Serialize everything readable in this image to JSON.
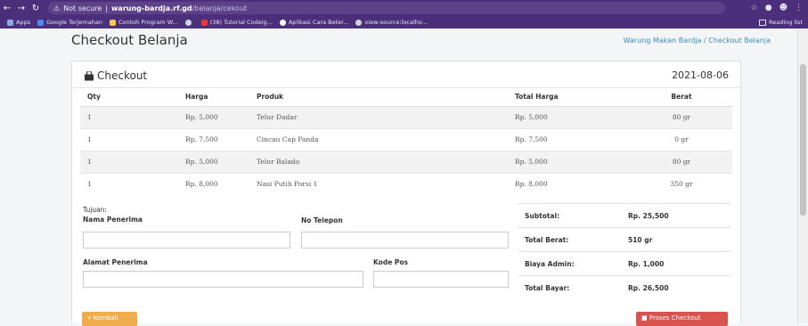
{
  "browser": {
    "security": "Not secure",
    "domain": "warung-bardja.rf.gd",
    "path": "/belanja/cekout",
    "bookmarks": [
      "Apps",
      "Google Terjemahan",
      "Contoh Program W...",
      "(38) Tutorial Codeig...",
      "Aplikasi Cara Beter...",
      "view-source:localho..."
    ],
    "reading_list": "Reading list"
  },
  "page": {
    "title": "Checkout Belanja",
    "breadcrumb": "Warung Makan Bardja  /  Checkout Belanja"
  },
  "card": {
    "title": "Checkout",
    "date": "2021-08-06"
  },
  "table": {
    "headers": [
      "Qty",
      "Harga",
      "Produk",
      "Total Harga",
      "Berat"
    ],
    "rows": [
      [
        "1",
        "Rp. 5,000",
        "Telur Dadar",
        "Rp. 5,000",
        "80 gr"
      ],
      [
        "1",
        "Rp. 7,500",
        "Cincau Cap Panda",
        "Rp. 7,500",
        "0 gr"
      ],
      [
        "1",
        "Rp. 5,000",
        "Telur Balado",
        "Rp. 5,000",
        "80 gr"
      ],
      [
        "1",
        "Rp. 8,000",
        "Nasi Putih Porsi 1",
        "Rp. 8,000",
        "350 gr"
      ]
    ]
  },
  "form": {
    "tujuan": "Tujuan:",
    "nama_label": "Nama Penerima",
    "telepon_label": "No Telepon",
    "alamat_label": "Alamat Penerima",
    "kodepos_label": "Kode Pos",
    "nama_value": "",
    "telepon_value": "",
    "alamat_value": "",
    "kodepos_value": ""
  },
  "summary": [
    {
      "label": "Subtotal:",
      "value": "Rp. 25,500"
    },
    {
      "label": "Total Berat:",
      "value": "510 gr"
    },
    {
      "label": "Biaya Admin:",
      "value": "Rp. 1,000"
    },
    {
      "label": "Total Bayar:",
      "value": "Rp. 26,500"
    }
  ],
  "buttons": {
    "back": "Kembali",
    "proses": "Proses Checkout"
  },
  "colors": {
    "browser_chrome": "#4b2f7a",
    "link": "#3c8dbc",
    "warning": "#f0ad4e",
    "danger": "#d9534f"
  }
}
